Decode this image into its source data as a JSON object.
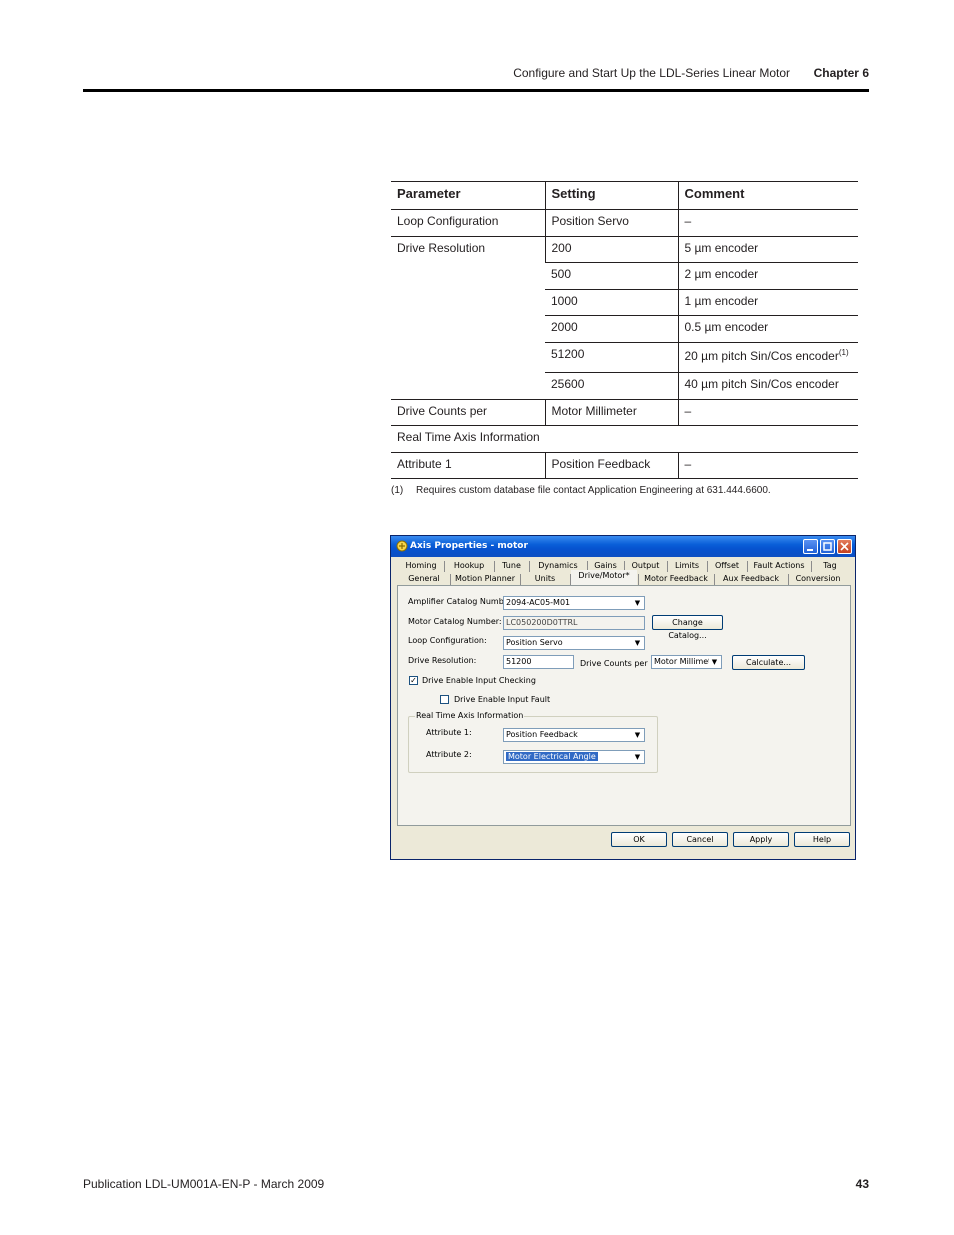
{
  "header": {
    "title": "Configure and Start Up the LDL-Series Linear Motor",
    "chapter": "Chapter 6"
  },
  "table": {
    "headers": [
      "Parameter",
      "Setting",
      "Comment"
    ],
    "rows": [
      {
        "parameter": "Loop Configuration",
        "setting": "Position Servo",
        "comment": "–"
      },
      {
        "parameter": "Drive Resolution",
        "setting": "200",
        "comment": "5 µm encoder"
      },
      {
        "setting": "500",
        "comment": "2 µm encoder"
      },
      {
        "setting": "1000",
        "comment": "1 µm encoder"
      },
      {
        "setting": "2000",
        "comment": "0.5 µm encoder"
      },
      {
        "setting": "51200",
        "comment": "20 µm pitch Sin/Cos encoder",
        "comment_note": "(1)"
      },
      {
        "setting": "25600",
        "comment": "40 µm pitch Sin/Cos encoder"
      },
      {
        "parameter": "Drive Counts per",
        "setting": "Motor Millimeter",
        "comment": "–"
      },
      {
        "parameter": "Real Time Axis Information"
      },
      {
        "parameter": "Attribute 1",
        "setting": "Position Feedback",
        "comment": "–"
      }
    ]
  },
  "footnote": {
    "number": "(1)",
    "text": "Requires custom database file contact Application Engineering at 631.444.6600."
  },
  "dialog": {
    "title": "Axis Properties - motor",
    "tabs_top": [
      "Homing",
      "Hookup",
      "Tune",
      "Dynamics",
      "Gains",
      "Output",
      "Limits",
      "Offset",
      "Fault Actions",
      "Tag"
    ],
    "tabs_bottom": [
      "General",
      "Motion Planner",
      "Units",
      "Drive/Motor*",
      "Motor Feedback",
      "Aux Feedback",
      "Conversion"
    ],
    "active_tab": "Drive/Motor*",
    "fields": {
      "amplifier_label": "Amplifier Catalog Number:",
      "amplifier_value": "2094-AC05-M01",
      "motor_label": "Motor Catalog Number:",
      "motor_value": "LC050200D0TTRL",
      "change_catalog": "Change Catalog...",
      "loop_label": "Loop Configuration:",
      "loop_value": "Position Servo",
      "resolution_label": "Drive Resolution:",
      "resolution_value": "51200",
      "counts_label": "Drive Counts per",
      "counts_value": "Motor Millimeter",
      "calculate": "Calculate...",
      "enable_checking": "Drive Enable Input Checking",
      "enable_checking_checked": true,
      "enable_fault": "Drive Enable Input Fault",
      "enable_fault_checked": false,
      "group_label": "Real Time Axis Information",
      "attr1_label": "Attribute 1:",
      "attr1_value": "Position Feedback",
      "attr2_label": "Attribute 2:",
      "attr2_value": "Motor Electrical Angle"
    },
    "buttons": {
      "ok": "OK",
      "cancel": "Cancel",
      "apply": "Apply",
      "help": "Help"
    }
  },
  "footer": {
    "publication": "Publication LDL-UM001A-EN-P - March 2009",
    "page": "43"
  }
}
